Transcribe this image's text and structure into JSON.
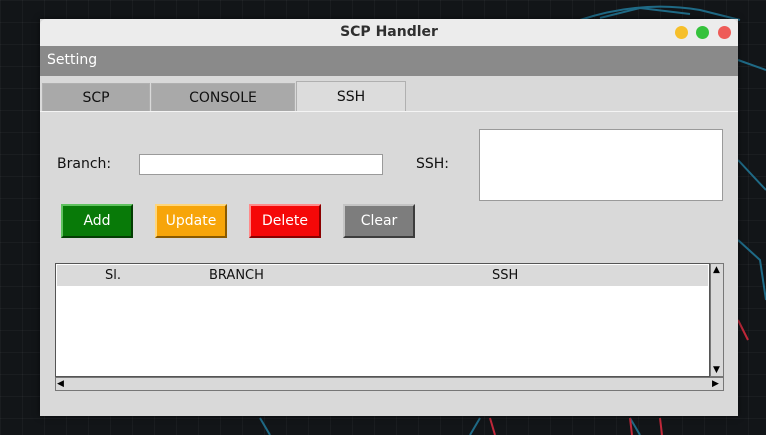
{
  "window": {
    "title": "SCP Handler"
  },
  "menu": {
    "items": [
      "Setting"
    ]
  },
  "tabs": [
    {
      "label": "SCP",
      "active": false
    },
    {
      "label": "CONSOLE",
      "active": false
    },
    {
      "label": "SSH",
      "active": true
    }
  ],
  "form": {
    "branch_label": "Branch:",
    "branch_value": "",
    "ssh_label": "SSH:",
    "ssh_value": ""
  },
  "buttons": {
    "add": "Add",
    "update": "Update",
    "delete": "Delete",
    "clear": "Clear"
  },
  "colors": {
    "add": "#087a08",
    "update": "#f7a50a",
    "delete": "#f50808",
    "clear": "#7d7d7d"
  },
  "table": {
    "columns": [
      "Sl.",
      "BRANCH",
      "SSH"
    ],
    "rows": []
  }
}
